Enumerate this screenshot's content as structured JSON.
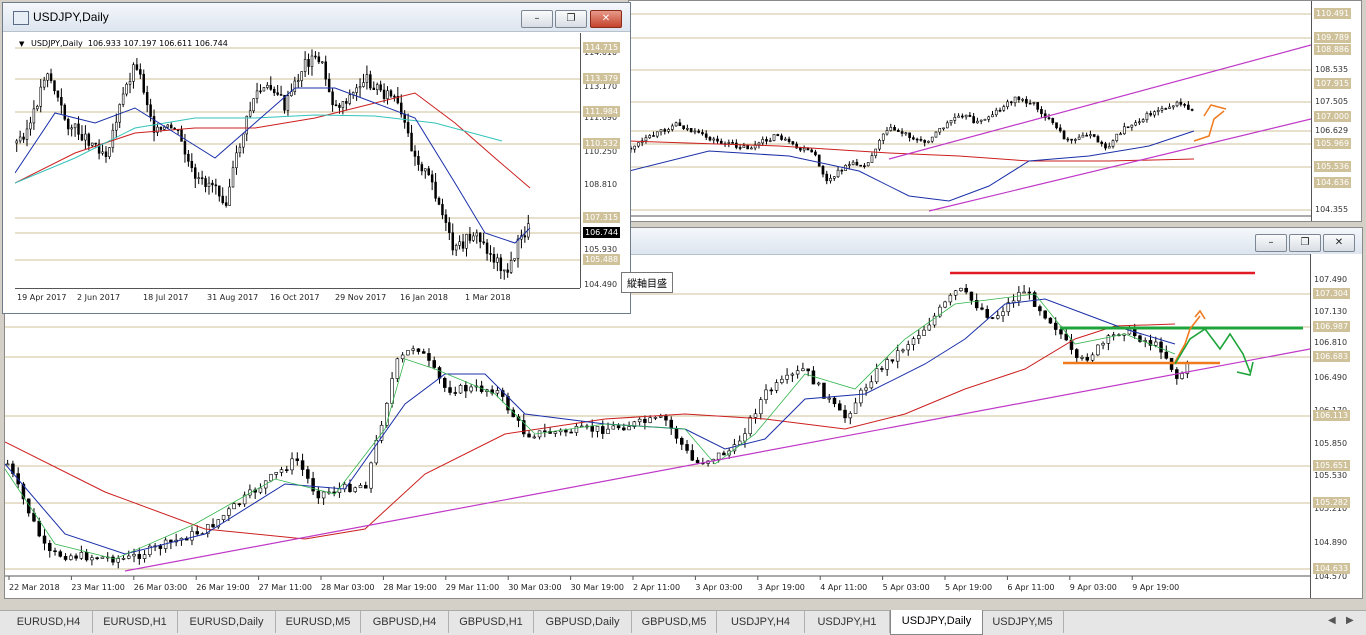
{
  "back_window": {
    "price_labels": [
      "110.491",
      "109.789",
      "108.886",
      "108.535",
      "107.915",
      "107.505",
      "107.000",
      "106.629",
      "105.969",
      "105.536",
      "104.636",
      "104.355"
    ],
    "current_price": "107.000"
  },
  "main_window": {
    "price_labels": [
      "107.304",
      "106.987",
      "106.683",
      "106.113",
      "105.651",
      "105.282",
      "104.633"
    ],
    "axis_ticks": [
      "107.490",
      "107.130",
      "106.810",
      "106.490",
      "106.170",
      "105.850",
      "105.530",
      "105.210",
      "104.890",
      "104.570"
    ],
    "date_labels": [
      "22 Mar 2018",
      "23 Mar 11:00",
      "26 Mar 03:00",
      "26 Mar 19:00",
      "27 Mar 11:00",
      "28 Mar 03:00",
      "28 Mar 19:00",
      "29 Mar 11:00",
      "30 Mar 03:00",
      "30 Mar 19:00",
      "2 Apr 11:00",
      "3 Apr 03:00",
      "3 Apr 19:00",
      "4 Apr 11:00",
      "5 Apr 03:00",
      "5 Apr 19:00",
      "6 Apr 11:00",
      "9 Apr 03:00",
      "9 Apr 19:00"
    ]
  },
  "daily_window": {
    "title": "USDJPY,Daily",
    "symbol_caption": "USDJPY,Daily",
    "ohlc": "106.933 107.197 106.611 106.744",
    "price_labels": [
      "114.715",
      "113.379",
      "111.984",
      "110.532",
      "107.315",
      "105.488"
    ],
    "current_price": "106.744",
    "axis_ticks": [
      "114.010",
      "113.170",
      "111.690",
      "110.250",
      "108.810",
      "105.930",
      "104.490"
    ],
    "date_labels": [
      "19 Apr 2017",
      "2 Jun 2017",
      "18 Jul 2017",
      "31 Aug 2017",
      "16 Oct 2017",
      "29 Nov 2017",
      "16 Jan 2018",
      "1 Mar 2018"
    ]
  },
  "tooltip": "縱軸目盛",
  "window_buttons": {
    "minimize": "–",
    "restore": "❐",
    "close": "✕"
  },
  "tabs": [
    "EURUSD,H4",
    "EURUSD,H1",
    "EURUSD,Daily",
    "EURUSD,M5",
    "GBPUSD,H4",
    "GBPUSD,H1",
    "GBPUSD,Daily",
    "GBPUSD,M5",
    "USDJPY,H4",
    "USDJPY,H1",
    "USDJPY,Daily",
    "USDJPY,M5"
  ],
  "active_tab": "USDJPY,Daily",
  "tab_nav": {
    "left": "◀",
    "right": "▶"
  },
  "colors": {
    "price_label_bg": "#cfc29b",
    "ma_red": "#cc1f1f",
    "ma_blue": "#1a2fa8",
    "ma_green": "#32b44c",
    "ma_teal": "#33c3bb",
    "trend_magenta": "#c038c8",
    "annot_red": "#e01b24",
    "annot_green": "#1ea43a",
    "annot_orange": "#f07a1e"
  }
}
